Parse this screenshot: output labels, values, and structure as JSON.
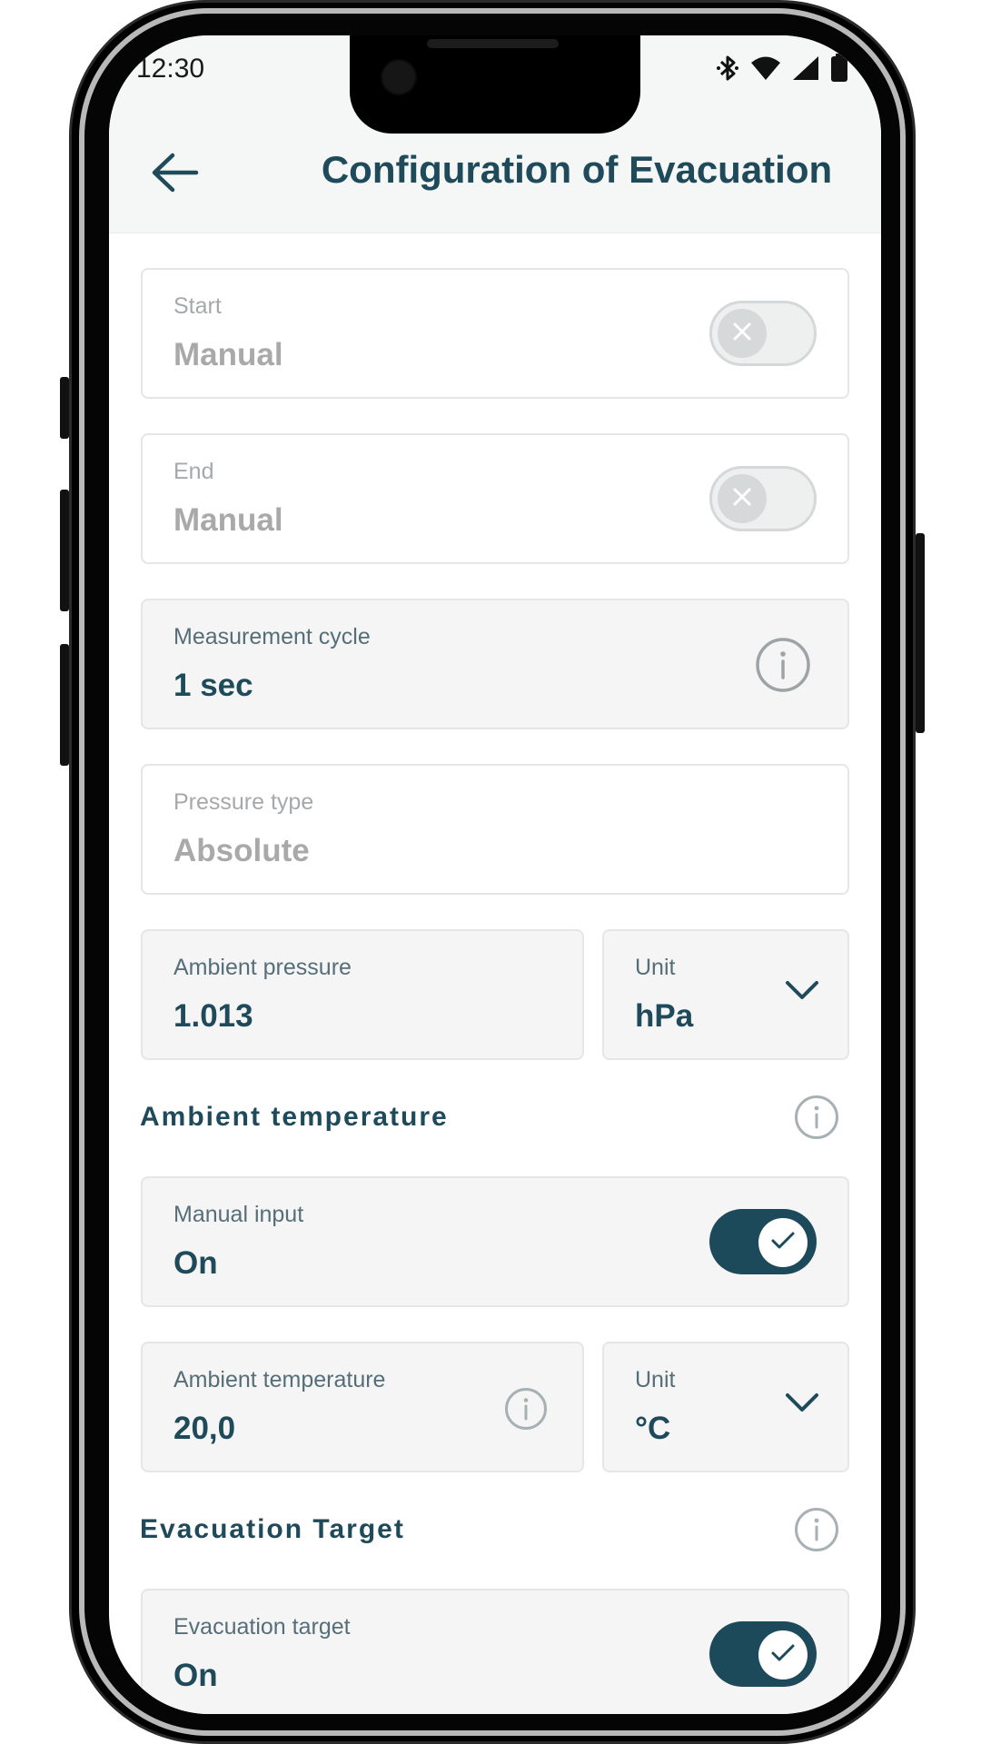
{
  "status_bar": {
    "time": "12:30",
    "icons": [
      "bluetooth-icon",
      "wifi-icon",
      "cellular-signal-icon",
      "battery-icon"
    ]
  },
  "app_bar": {
    "back_icon": "arrow-left-icon",
    "title": "Configuration of Evacuation"
  },
  "start": {
    "label": "Start",
    "value": "Manual",
    "toggle": "off"
  },
  "end": {
    "label": "End",
    "value": "Manual",
    "toggle": "off"
  },
  "measurement_cycle": {
    "label": "Measurement cycle",
    "value": "1 sec"
  },
  "pressure_type": {
    "label": "Pressure type",
    "value": "Absolute"
  },
  "ambient_pressure": {
    "label": "Ambient pressure",
    "value": "1.013"
  },
  "pressure_unit": {
    "label": "Unit",
    "value": "hPa"
  },
  "ambient_temperature_section": {
    "title": "Ambient temperature"
  },
  "manual_input": {
    "label": "Manual input",
    "value": "On",
    "toggle": "on"
  },
  "ambient_temperature": {
    "label": "Ambient temperature",
    "value": "20,0"
  },
  "temperature_unit": {
    "label": "Unit",
    "value": "°C"
  },
  "evacuation_target_section": {
    "title": "Evacuation Target"
  },
  "evacuation_target": {
    "label": "Evacuation target",
    "value": "On",
    "toggle": "on"
  },
  "colors": {
    "primary": "#1e4a5a",
    "label": "#566e79",
    "disabled": "#a9a9a9",
    "toggle_on": "#1d4a5b",
    "field_bg": "#f5f5f5"
  }
}
